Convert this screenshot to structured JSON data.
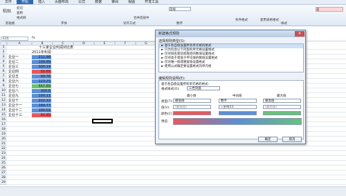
{
  "colors": {
    "accent": "#2f6ab0",
    "red_bar": "#e8585b",
    "blue_bar": "#5b8ed6",
    "green_bar": "#69c27a"
  },
  "tabs": [
    "文件",
    "开始",
    "插入",
    "页面布局",
    "公式",
    "数据",
    "审阅",
    "视图",
    "开发工具"
  ],
  "ribbon": {
    "paste": "粘贴",
    "cut": "剪切",
    "copy": "复制",
    "format_painter": "格式刷",
    "clipboard": "剪贴板",
    "font": "字体",
    "alignment": "对齐方式",
    "merge": "合并后居中",
    "number": "数字",
    "general": "常规",
    "conditional": "条件格式",
    "table_format": "套用表格格式",
    "cell_styles": "单元格样式",
    "styles": "样式",
    "normal": "常规",
    "bad": "差"
  },
  "namebox": "E15",
  "fx": "fx",
  "columns": [
    "A",
    "B",
    "C",
    "D",
    "E",
    "F",
    "G"
  ],
  "sheet": {
    "title": "十三家企业利润对比表",
    "year": "2011年利润",
    "rows": [
      {
        "label": "企业一",
        "value": "211.98",
        "color": "#5b8ed6"
      },
      {
        "label": "企业二",
        "value": "199.99",
        "color": "#5b8ed6"
      },
      {
        "label": "企业三",
        "value": "300.14",
        "color": "#5b8ed6"
      },
      {
        "label": "企业四",
        "value": "50.65",
        "color": "#e8585b"
      },
      {
        "label": "企业五",
        "value": "99.78",
        "color": "#5b8ed6"
      },
      {
        "label": "企业六",
        "value": "123.25",
        "color": "#5b8ed6"
      },
      {
        "label": "企业七",
        "value": "567.89",
        "color": "#69c27a"
      },
      {
        "label": "企业八",
        "value": "300.6",
        "color": "#5b8ed6"
      },
      {
        "label": "企业九",
        "value": "100.11",
        "color": "#5b8ed6"
      },
      {
        "label": "企业十",
        "value": "222.22",
        "color": "#5b8ed6"
      },
      {
        "label": "企业十一",
        "value": "189.77",
        "color": "#5b8ed6"
      },
      {
        "label": "企业十二",
        "value": "100.01",
        "color": "#5b8ed6"
      },
      {
        "label": "企业十三",
        "value": "60.85",
        "color": "#e8585b"
      }
    ]
  },
  "dialog": {
    "title": "新建格式规则",
    "select_type": "选择规则类型(S):",
    "rules": [
      "► 基于各自值设置所有单元格的格式",
      "► 只为包含以下内容的单元格设置格式",
      "► 仅对排名靠前或靠后的数值设置格式",
      "► 仅对高于或低于平均值的数值设置格式",
      "► 仅对唯一值或重复值设置格式",
      "► 使用公式确定要设置格式的单元格"
    ],
    "edit_desc": "编辑规则说明(E):",
    "based_on": "基于各自值设置所有单元格的格式:",
    "format_style_label": "格式样式(O):",
    "format_style": "三色刻度",
    "min": "最小值",
    "mid": "中间值",
    "max": "最大值",
    "type_label": "类型(T):",
    "value_label": "值(V):",
    "color_label": "颜色(C):",
    "min_type": "最低值",
    "mid_type": "数字",
    "max_type": "最高值",
    "min_val": "(最低值)",
    "mid_val": "=$H$11",
    "max_val": "(最高值)",
    "preview": "预览:",
    "ok": "确定",
    "cancel": "取消"
  }
}
